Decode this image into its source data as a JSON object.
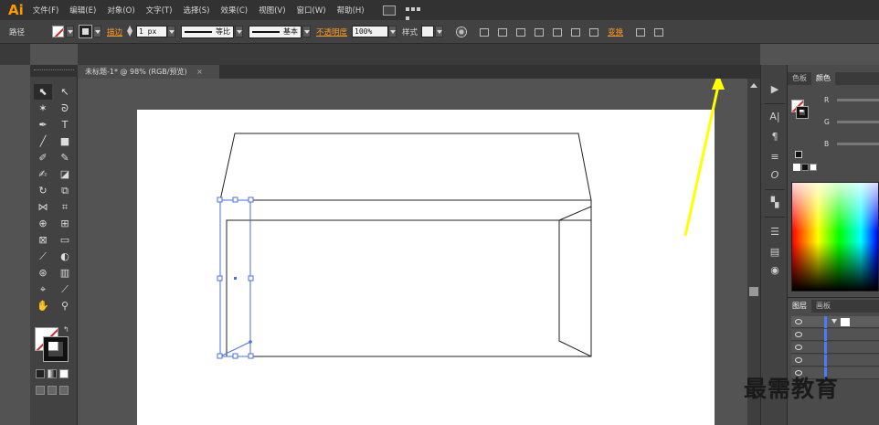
{
  "app": {
    "logo": "Ai"
  },
  "menu": [
    "文件(F)",
    "编辑(E)",
    "对象(O)",
    "文字(T)",
    "选择(S)",
    "效果(C)",
    "视图(V)",
    "窗口(W)",
    "帮助(H)"
  ],
  "control_bar": {
    "selection_label": "路径",
    "stroke_label": "描边",
    "stroke_weight": "1 px",
    "variable_width_profile": "等比",
    "brush_definition": "基本",
    "opacity_label": "不透明度",
    "opacity_value": "100%",
    "style_label": "样式",
    "transform_label": "变换"
  },
  "document_tab": {
    "title": "未标题-1* @ 98% (RGB/预览)",
    "close": "×"
  },
  "color_panel": {
    "tabs": [
      "色板",
      "颜色"
    ],
    "active_tab": "颜色",
    "channels": [
      "R",
      "G",
      "B"
    ]
  },
  "layers_panel": {
    "tabs": [
      "图层",
      "画板"
    ]
  },
  "watermark": "最需教育",
  "colors": {
    "accent_orange": "#ff9a1f",
    "annotation_arrow": "#ffff00",
    "selection_blue": "#4a6fe0"
  }
}
